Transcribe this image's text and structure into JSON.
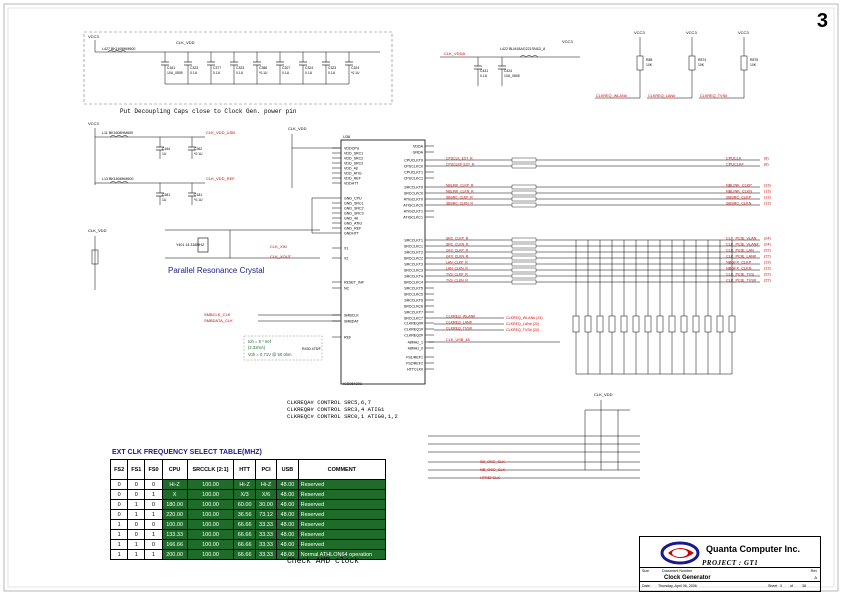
{
  "page_number": "3",
  "ic": {
    "name": "ICS954201",
    "left_pins": [
      "VDDCPU",
      "VDD_SRC1",
      "VDD_SRC2",
      "VDD_SRC3",
      "VDD_48",
      "VDD_ATIG",
      "VDD_REF",
      "VDDHTT",
      "GND_CPU",
      "GND_SRC1",
      "GND_SRC2",
      "GND_SRC3",
      "GND_48",
      "GND_ATIG",
      "GND_REF",
      "GNDHTT",
      "X1",
      "X2",
      "RESET_IN#",
      "NC",
      "SMBCLK",
      "SMBDAT",
      "REF"
    ],
    "right_pins": [
      "VDDA",
      "GNDA",
      "CPUCLKT0",
      "CPUCLKC0",
      "CPUCLKT1",
      "CPUCLKC1",
      "SRCCLKT0",
      "SRCCLKC0",
      "ATIGCLKT0",
      "ATIGCLKC0",
      "ATIGCLKT1",
      "ATIGCLKC1",
      "SRCCLKT1",
      "SRCCLKC1",
      "SRCCLKT2",
      "SRCCLKC2",
      "SRCCLKT3",
      "SRCCLKC3",
      "SRCCLKT4",
      "SRCCLKC4",
      "SRCCLKT5",
      "SRCCLKC5",
      "SRCCLKT6",
      "SRCCLKC6",
      "SRCCLKT7",
      "SRCCLKC7",
      "CLKREQ0#",
      "CLKREQ1#",
      "CLKREQ2#",
      "48MHz_1",
      "48MHz_0",
      "FS1/REF1",
      "FS2/REF2",
      "HTTCLK0"
    ]
  },
  "nets": {
    "vcc3": "VCC3",
    "clk_vdd": "CLK_VDD",
    "clk_vdda": "CLK_VDDA",
    "clk_vdd_usb": "CLK_VDD_USB",
    "clk_vdd_ref": "CLK_VDD_REF",
    "clk_xin": "CLK_XIN",
    "clk_xout": "CLK_XOUT",
    "smbclk": "SMBCLK_CLK",
    "smbdata": "SMBDATA_CLK",
    "cpuclk_ext_r": "CPUCLK_EXT_R",
    "cpuclk_ext_r2": "CPUCLK#_EXT_R",
    "cpuclk": "CPUCLK",
    "cpuclk_n": "CPUCLK#",
    "clk_usb": "CLK_USB_48",
    "sb_osc": "SB_OSC_CLK",
    "nb_osc": "NB_OSC_CLK",
    "httclk": "HTREFCLK"
  },
  "components": {
    "l427": "L427  BK1608HM600",
    "l11": "L11  BK1608HM600",
    "l13": "L13  BK1608HM600",
    "l422": "L422  BLM18AG221SN1D_8",
    "crystal": "Y401 14.318MHZ",
    "crystal_label": "Parallel Resonance Crystal",
    "r_notes": "Ioh = 5 * Iref (2.32mA)\nVoh = 0.71V @ 50 ohm",
    "r_ref": "R430 475/F",
    "caps_decoupling": [
      "C161 10U_0805",
      "C323 0.1U",
      "C377 0.1U",
      "C323 0.1U",
      "C386 *0.1U",
      "C207 0.1U",
      "C324 0.1U",
      "C323 0.1U",
      "C324 *0.1U"
    ],
    "caps_vdda": [
      "C431 0.1U",
      "C424 10U_0805"
    ]
  },
  "notes": {
    "decoupling": "Put Decoupling Caps close to Clock Gen. power pin",
    "clkreq0": "CLKREQA# CONTROL SRC5,6,7",
    "clkreq1": "CLKREQB# CONTROL SRC3,4 ATIG1",
    "clkreq2": "CLKREQC# CONTROL SRC0,1 ATIG0,1,2",
    "check": "Check AMD clock"
  },
  "outputs": [
    {
      "net": "CPUCLK",
      "page": "(8)"
    },
    {
      "net": "CPUCLK#",
      "page": "(8)"
    },
    {
      "net": "NBLINK_CLKP",
      "page": "(13)"
    },
    {
      "net": "NBLINK_CLKN",
      "page": "(13)"
    },
    {
      "net": "SBSRC_CLKP",
      "page": "(13)"
    },
    {
      "net": "SBSRC_CLKN",
      "page": "(13)"
    },
    {
      "net": "CLK_PCIE_VLAN",
      "page": "(24)"
    },
    {
      "net": "CLK_PCIE_VLAN#",
      "page": "(24)"
    },
    {
      "net": "CLK_PCIE_LAN",
      "page": "(22)"
    },
    {
      "net": "CLK_PCIE_LAN#",
      "page": "(22)"
    },
    {
      "net": "NBGFX_CLKP",
      "page": "(13)"
    },
    {
      "net": "NBGFX_CLKN",
      "page": "(13)"
    },
    {
      "net": "CLK_PCIE_TVS",
      "page": "(22)"
    },
    {
      "net": "CLK_PCIE_TVS#",
      "page": "(22)"
    }
  ],
  "clkreq_outputs": [
    {
      "net": "CLKREQ_WLAN#",
      "page": "(24)"
    },
    {
      "net": "CLKREQ_LAN#",
      "page": "(22)"
    },
    {
      "net": "CLKREQ_TVS#",
      "page": "(22)"
    }
  ],
  "top_right_pulls": [
    "R88 10K",
    "R874 10K",
    "R875 10K"
  ],
  "top_right_nets": [
    "CLKREQ_WLAN#",
    "CLKREQ_LAN#",
    "CLKREQ_TVS#"
  ],
  "freq_table": {
    "title": "EXT CLK FREQUENCY SELECT TABLE(MHZ)",
    "headers": [
      "FS2",
      "FS1",
      "FS0",
      "CPU",
      "SRCCLK [2:1]",
      "HTT",
      "PCI",
      "USB",
      "COMMENT"
    ],
    "rows": [
      [
        "0",
        "0",
        "0",
        "Hi-Z",
        "100.00",
        "Hi-Z",
        "Hi-Z",
        "48.00",
        "Reserved"
      ],
      [
        "0",
        "0",
        "1",
        "X",
        "100.00",
        "X/3",
        "X/6",
        "48.00",
        "Reserved"
      ],
      [
        "0",
        "1",
        "0",
        "180.00",
        "100.00",
        "60.00",
        "30.00",
        "48.00",
        "Reserved"
      ],
      [
        "0",
        "1",
        "1",
        "220.00",
        "100.00",
        "36.56",
        "73.12",
        "48.00",
        "Reserved"
      ],
      [
        "1",
        "0",
        "0",
        "100.00",
        "100.00",
        "66.66",
        "33.33",
        "48.00",
        "Reserved"
      ],
      [
        "1",
        "0",
        "1",
        "133.33",
        "100.00",
        "66.66",
        "33.33",
        "48.00",
        "Reserved"
      ],
      [
        "1",
        "1",
        "0",
        "166.66",
        "100.00",
        "66.66",
        "33.33",
        "48.00",
        "Reserved"
      ],
      [
        "1",
        "1",
        "1",
        "200.00",
        "100.00",
        "66.66",
        "33.33",
        "48.00",
        "Normal ATHLON64 operation"
      ]
    ]
  },
  "title_block": {
    "company": "Quanta Computer Inc.",
    "project": "PROJECT : GT1",
    "title": "Clock Generator",
    "size": "Size",
    "doc_label": "Document Number",
    "rev_label": "Rev",
    "rev": "A",
    "date": "Thursday, April 06, 2006",
    "sheet": "3",
    "of": "of",
    "total": "38"
  },
  "colors": {
    "wire": "#000000",
    "net_label": "#cc0000",
    "accent_blue": "#1a1a8c",
    "table_green": "#1f6b2a"
  }
}
